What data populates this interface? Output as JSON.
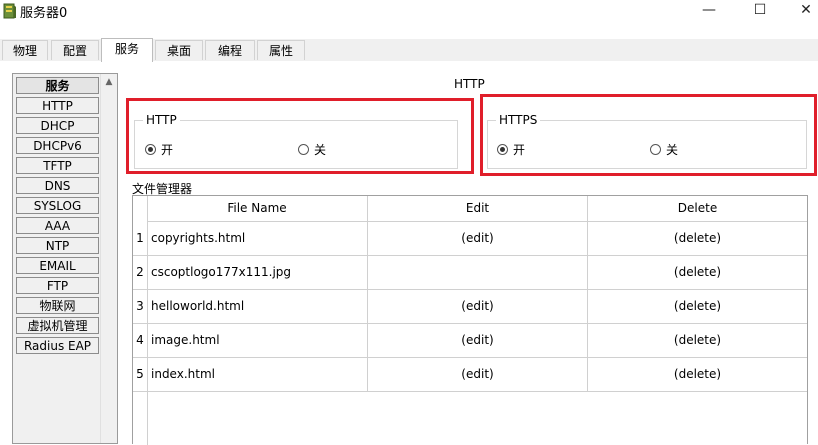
{
  "window": {
    "title": "服务器0",
    "minimize": "—",
    "maximize": "☐",
    "close": "✕"
  },
  "tabs": [
    "物理",
    "配置",
    "服务",
    "桌面",
    "编程",
    "属性"
  ],
  "sidebar": {
    "header": "服务",
    "items": [
      "HTTP",
      "DHCP",
      "DHCPv6",
      "TFTP",
      "DNS",
      "SYSLOG",
      "AAA",
      "NTP",
      "EMAIL",
      "FTP",
      "物联网",
      "虚拟机管理",
      "Radius EAP"
    ],
    "scroll_up": "▲"
  },
  "main": {
    "heading": "HTTP",
    "http_group": {
      "label": "HTTP",
      "on_label": "开",
      "off_label": "关",
      "selected": "on"
    },
    "https_group": {
      "label": "HTTPS",
      "on_label": "开",
      "off_label": "关",
      "selected": "on"
    },
    "file_manager_label": "文件管理器",
    "table": {
      "headers": [
        "File Name",
        "Edit",
        "Delete"
      ],
      "rows": [
        {
          "num": "1",
          "name": "copyrights.html",
          "edit": "(edit)",
          "delete": "(delete)"
        },
        {
          "num": "2",
          "name": "cscoptlogo177x111.jpg",
          "edit": "",
          "delete": "(delete)"
        },
        {
          "num": "3",
          "name": "helloworld.html",
          "edit": "(edit)",
          "delete": "(delete)"
        },
        {
          "num": "4",
          "name": "image.html",
          "edit": "(edit)",
          "delete": "(delete)"
        },
        {
          "num": "5",
          "name": "index.html",
          "edit": "(edit)",
          "delete": "(delete)"
        }
      ]
    }
  },
  "colors": {
    "highlight_box": "#e01e2a"
  }
}
